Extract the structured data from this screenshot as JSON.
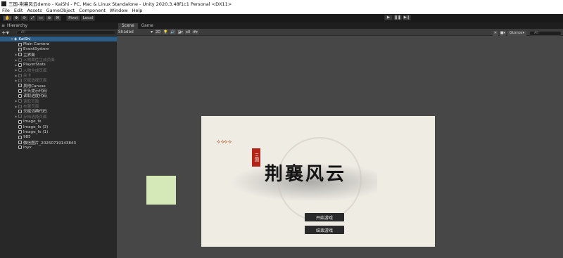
{
  "window": {
    "title": "三国-荆襄风云demo - KaiShi - PC, Mac & Linux Standalone - Unity 2020.3.48f1c1 Personal <DX11>"
  },
  "menu": [
    "File",
    "Edit",
    "Assets",
    "GameObject",
    "Component",
    "Window",
    "Help"
  ],
  "toolbar": {
    "pivot": "Pivot",
    "local": "Local"
  },
  "hierarchy": {
    "tab": "Hierarchy",
    "search_placeholder": "All",
    "root": "KaiShi",
    "items": [
      {
        "label": "Main Camera",
        "dim": false,
        "expandable": false
      },
      {
        "label": "EventSystem",
        "dim": false,
        "expandable": false
      },
      {
        "label": "主界面",
        "dim": false,
        "expandable": true
      },
      {
        "label": "人物属性生成页面",
        "dim": true,
        "expandable": true
      },
      {
        "label": "PlayerStats",
        "dim": false,
        "expandable": true
      },
      {
        "label": "人物生成页面",
        "dim": true,
        "expandable": true
      },
      {
        "label": "关卡",
        "dim": true,
        "expandable": true
      },
      {
        "label": "天赋选择页面",
        "dim": true,
        "expandable": true
      },
      {
        "label": "其他Canvas",
        "dim": false,
        "expandable": false
      },
      {
        "label": "开头提示代码",
        "dim": false,
        "expandable": false
      },
      {
        "label": "读取进度代码",
        "dim": false,
        "expandable": false
      },
      {
        "label": "读取页面",
        "dim": true,
        "expandable": true
      },
      {
        "label": "布置页面",
        "dim": true,
        "expandable": true
      },
      {
        "label": "天赋词典代码",
        "dim": false,
        "expandable": false
      },
      {
        "label": "存档选择页面",
        "dim": true,
        "expandable": true
      },
      {
        "label": "Image_fx",
        "dim": false,
        "expandable": false
      },
      {
        "label": "Image_fx (3)",
        "dim": false,
        "expandable": false
      },
      {
        "label": "Image_fx (1)",
        "dim": false,
        "expandable": false
      },
      {
        "label": "985",
        "dim": false,
        "expandable": false
      },
      {
        "label": "微信图片_20250719143843",
        "dim": false,
        "expandable": false
      },
      {
        "label": "Inyx",
        "dim": false,
        "expandable": false
      }
    ]
  },
  "scene": {
    "tabs": [
      "Scene",
      "Game"
    ],
    "shading": "Shaded",
    "mode_2d": "2D",
    "hidden_count": "0",
    "gizmos": "Gizmos",
    "search_placeholder": "All"
  },
  "game_preview": {
    "seal_text": "三国",
    "title": "荆襄风云",
    "buttons": [
      "开始游戏",
      "结束游戏"
    ]
  },
  "colors": {
    "selection": "#2c5d87",
    "green_square": "#d5e9b8",
    "seal_red": "#b32317"
  }
}
